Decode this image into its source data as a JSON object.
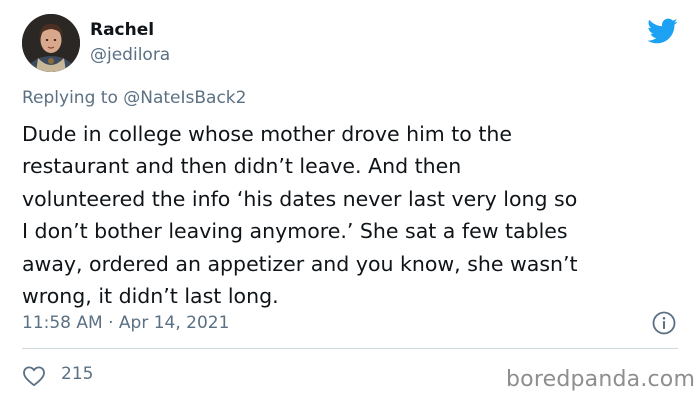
{
  "user": {
    "display_name": "Rachel",
    "handle": "@jedilora"
  },
  "reply": {
    "prefix": "Replying to ",
    "mention": "@NateIsBack2"
  },
  "tweet": {
    "lines": [
      "Dude in college whose mother drove him to the",
      "restaurant and then didn’t leave. And then",
      "volunteered the info ‘his dates never last very long so",
      "I don’t bother leaving anymore.’ She sat a few tables",
      "away, ordered an appetizer and you know, she wasn’t",
      "wrong, it didn’t last long."
    ],
    "timestamp": "11:58 AM · Apr 14, 2021",
    "likes": "215"
  },
  "icons": {
    "brand": "twitter-bird-icon",
    "info": "info-icon",
    "like": "heart-icon"
  },
  "colors": {
    "twitter_blue": "#1da1f2",
    "muted_text": "#5b7083",
    "body_text": "#0f1419",
    "divider": "#cfd9de"
  },
  "watermark": "boredpanda.com"
}
